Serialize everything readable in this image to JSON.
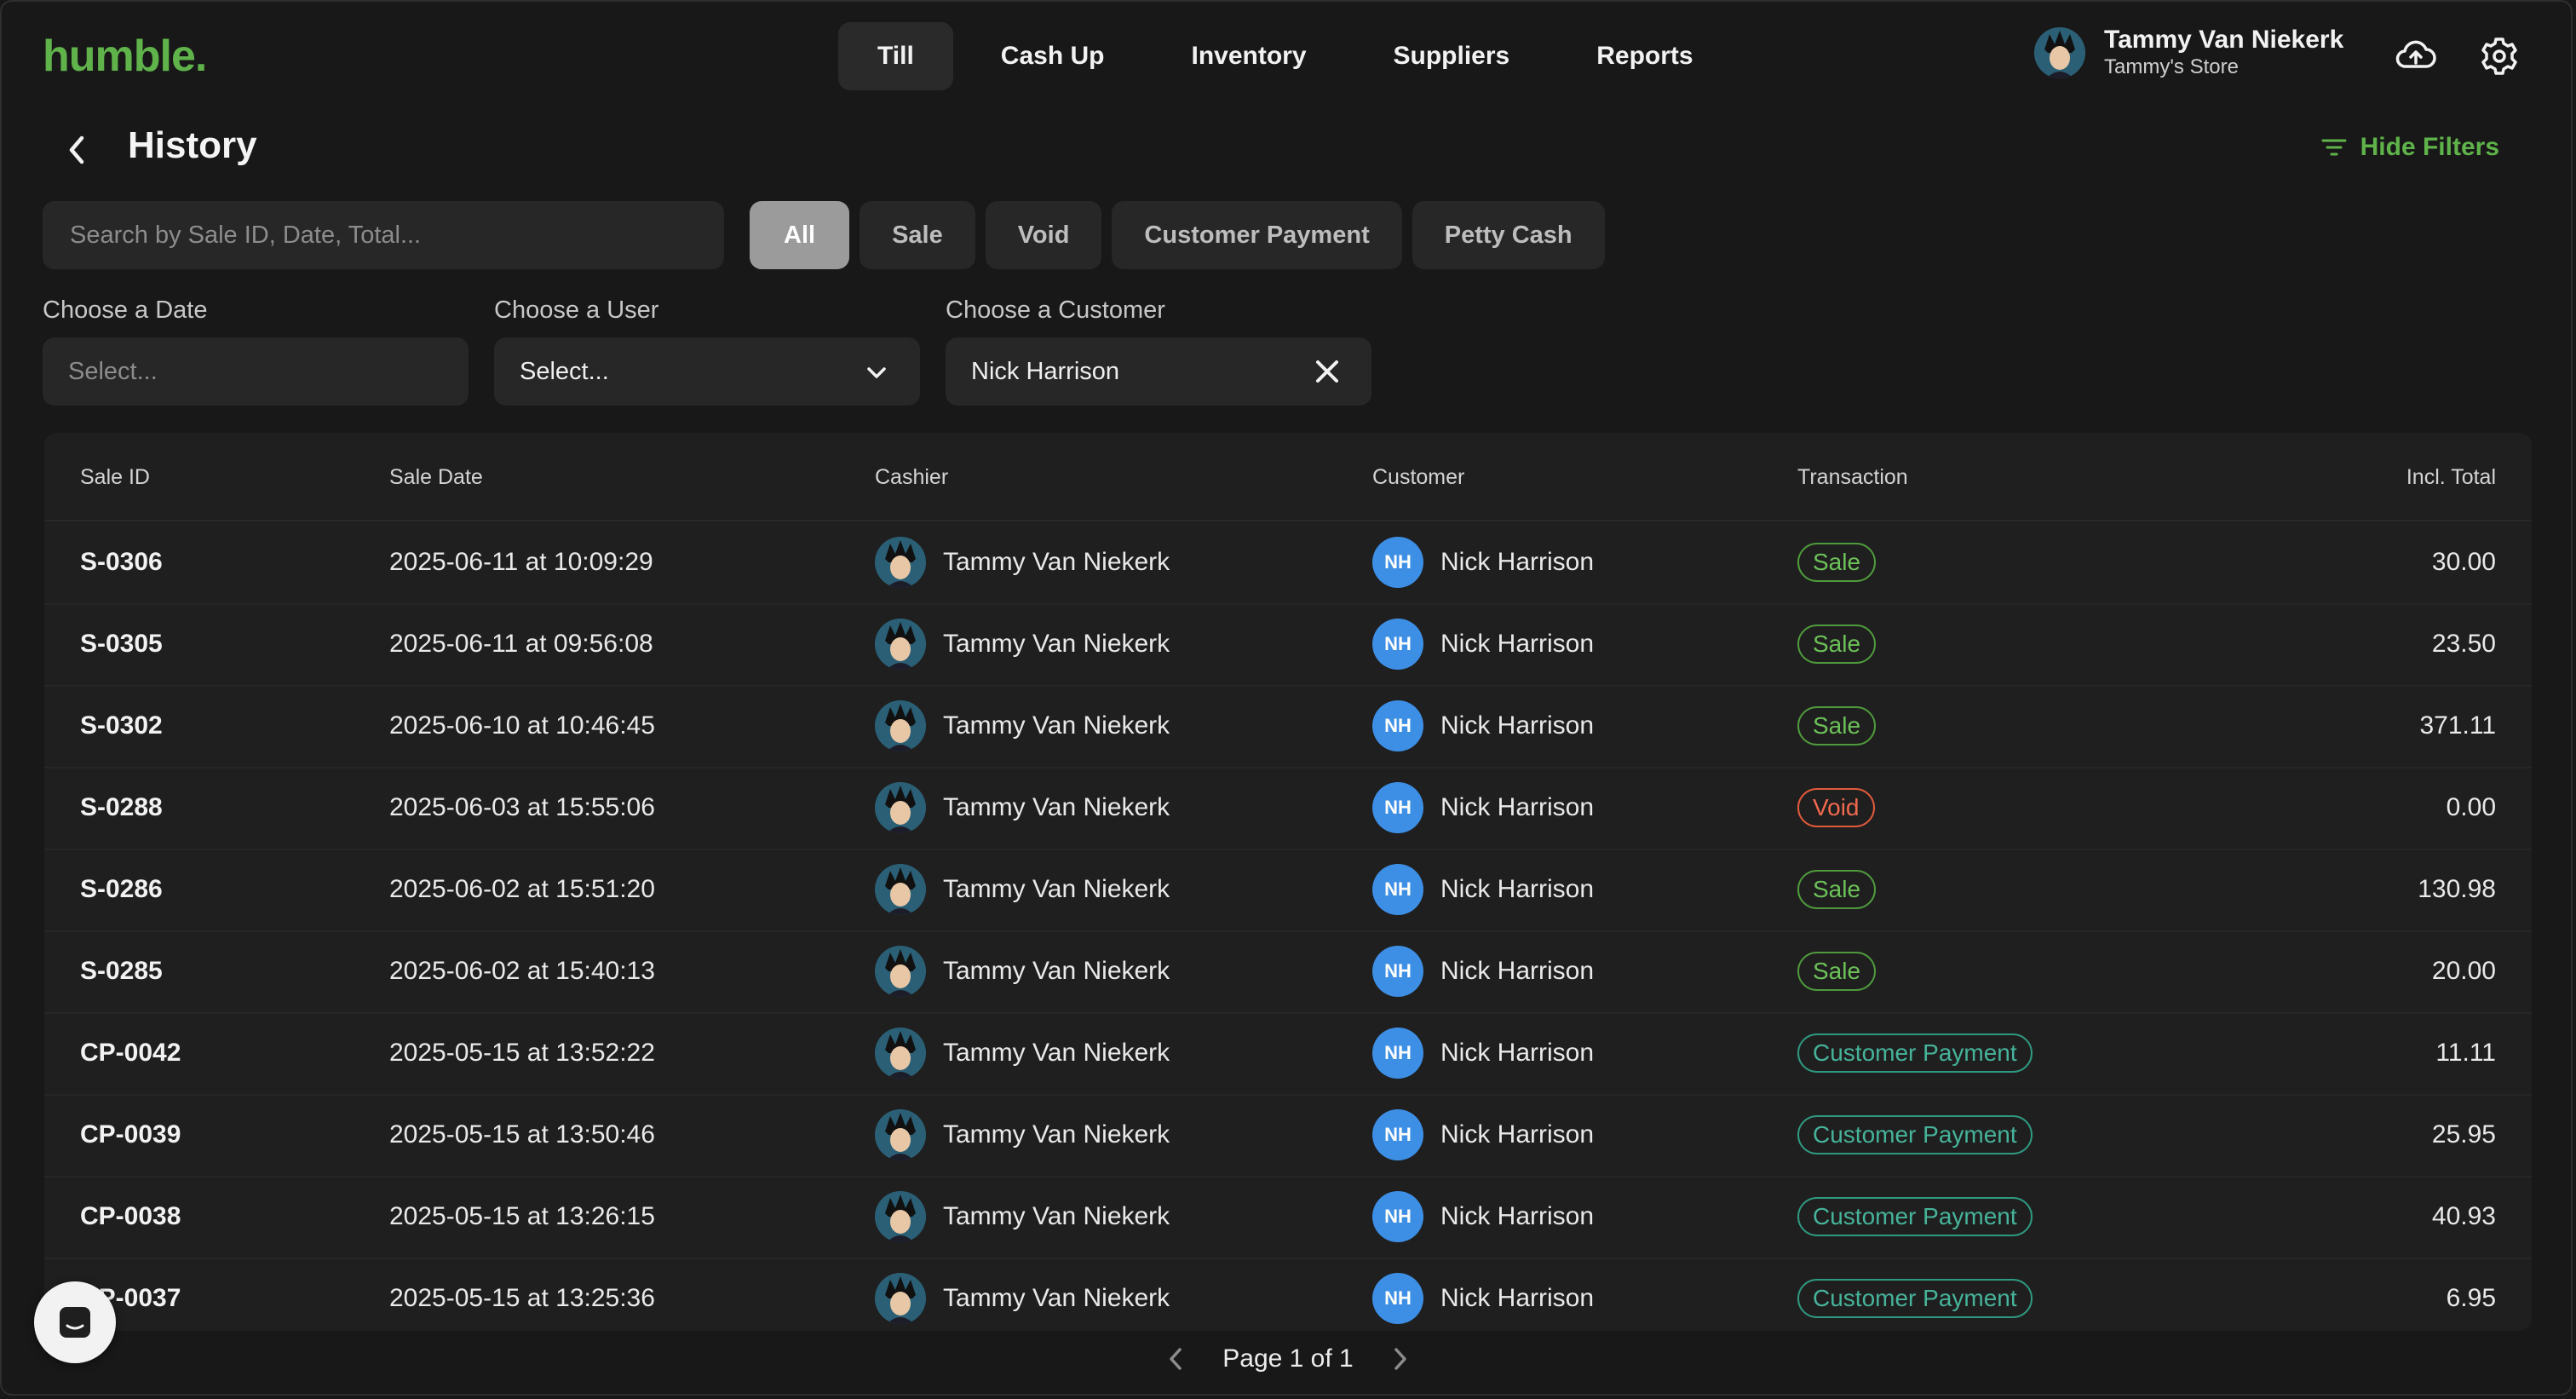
{
  "app": {
    "logo": "humble."
  },
  "nav": {
    "tabs": [
      {
        "label": "Till",
        "active": true
      },
      {
        "label": "Cash Up"
      },
      {
        "label": "Inventory"
      },
      {
        "label": "Suppliers"
      },
      {
        "label": "Reports"
      }
    ]
  },
  "user": {
    "name": "Tammy Van Niekerk",
    "store": "Tammy's Store"
  },
  "page": {
    "title": "History",
    "hide_filters": "Hide Filters"
  },
  "search": {
    "placeholder": "Search by Sale ID, Date, Total..."
  },
  "chips": [
    {
      "label": "All",
      "active": true
    },
    {
      "label": "Sale"
    },
    {
      "label": "Void"
    },
    {
      "label": "Customer Payment"
    },
    {
      "label": "Petty Cash"
    }
  ],
  "filters": {
    "date": {
      "label": "Choose a Date",
      "placeholder": "Select..."
    },
    "user": {
      "label": "Choose a User",
      "value": "Select..."
    },
    "customer": {
      "label": "Choose a Customer",
      "value": "Nick Harrison"
    }
  },
  "table": {
    "headers": [
      "Sale ID",
      "Sale Date",
      "Cashier",
      "Customer",
      "Transaction",
      "Incl. Total"
    ],
    "rows": [
      {
        "id": "S-0306",
        "date": "2025-06-11 at 10:09:29",
        "cashier": "Tammy Van Niekerk",
        "initials": "NH",
        "customer": "Nick Harrison",
        "type": "Sale",
        "total": "30.00"
      },
      {
        "id": "S-0305",
        "date": "2025-06-11 at 09:56:08",
        "cashier": "Tammy Van Niekerk",
        "initials": "NH",
        "customer": "Nick Harrison",
        "type": "Sale",
        "total": "23.50"
      },
      {
        "id": "S-0302",
        "date": "2025-06-10 at 10:46:45",
        "cashier": "Tammy Van Niekerk",
        "initials": "NH",
        "customer": "Nick Harrison",
        "type": "Sale",
        "total": "371.11"
      },
      {
        "id": "S-0288",
        "date": "2025-06-03 at 15:55:06",
        "cashier": "Tammy Van Niekerk",
        "initials": "NH",
        "customer": "Nick Harrison",
        "type": "Void",
        "total": "0.00"
      },
      {
        "id": "S-0286",
        "date": "2025-06-02 at 15:51:20",
        "cashier": "Tammy Van Niekerk",
        "initials": "NH",
        "customer": "Nick Harrison",
        "type": "Sale",
        "total": "130.98"
      },
      {
        "id": "S-0285",
        "date": "2025-06-02 at 15:40:13",
        "cashier": "Tammy Van Niekerk",
        "initials": "NH",
        "customer": "Nick Harrison",
        "type": "Sale",
        "total": "20.00"
      },
      {
        "id": "CP-0042",
        "date": "2025-05-15 at 13:52:22",
        "cashier": "Tammy Van Niekerk",
        "initials": "NH",
        "customer": "Nick Harrison",
        "type": "Customer Payment",
        "total": "11.11"
      },
      {
        "id": "CP-0039",
        "date": "2025-05-15 at 13:50:46",
        "cashier": "Tammy Van Niekerk",
        "initials": "NH",
        "customer": "Nick Harrison",
        "type": "Customer Payment",
        "total": "25.95"
      },
      {
        "id": "CP-0038",
        "date": "2025-05-15 at 13:26:15",
        "cashier": "Tammy Van Niekerk",
        "initials": "NH",
        "customer": "Nick Harrison",
        "type": "Customer Payment",
        "total": "40.93"
      },
      {
        "id": "CP-0037",
        "date": "2025-05-15 at 13:25:36",
        "cashier": "Tammy Van Niekerk",
        "initials": "NH",
        "customer": "Nick Harrison",
        "type": "Customer Payment",
        "total": "6.95"
      }
    ]
  },
  "pagination": {
    "label": "Page 1 of 1"
  },
  "colors": {
    "brand": "#5fb34a",
    "sale": "#6cc158",
    "void": "#f06a4e",
    "customer_payment": "#46b39a",
    "initials_bg": "#3d8fe6"
  },
  "icons": [
    "back-arrow-icon",
    "filter-icon",
    "cloud-upload-icon",
    "gear-icon",
    "chevron-down-icon",
    "close-icon",
    "chat-icon",
    "chevron-left-icon",
    "chevron-right-icon"
  ]
}
